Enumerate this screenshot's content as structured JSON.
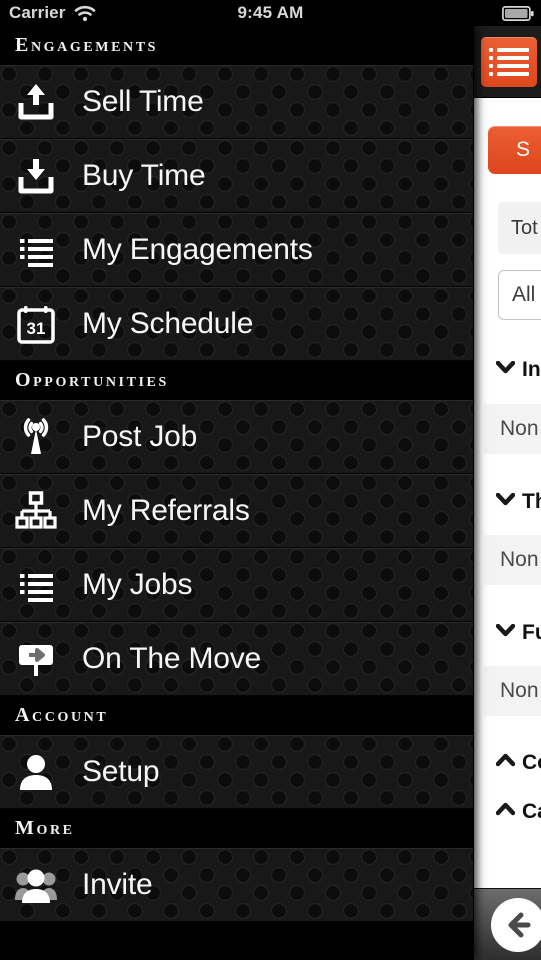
{
  "status_bar": {
    "carrier": "Carrier",
    "time": "9:45 AM",
    "wifi_icon": "wifi-icon",
    "battery_icon": "battery-icon"
  },
  "drawer": {
    "sections": [
      {
        "header": "Engagements",
        "items": [
          {
            "label": "Sell Time",
            "icon": "upload-tray-icon"
          },
          {
            "label": "Buy Time",
            "icon": "download-tray-icon"
          },
          {
            "label": "My Engagements",
            "icon": "list-icon"
          },
          {
            "label": "My Schedule",
            "icon": "calendar-31-icon"
          }
        ]
      },
      {
        "header": "Opportunities",
        "items": [
          {
            "label": "Post Job",
            "icon": "broadcast-antenna-icon"
          },
          {
            "label": "My Referrals",
            "icon": "org-chart-icon"
          },
          {
            "label": "My Jobs",
            "icon": "list-icon"
          },
          {
            "label": "On The Move",
            "icon": "signpost-arrow-icon"
          }
        ]
      },
      {
        "header": "Account",
        "items": [
          {
            "label": "Setup",
            "icon": "person-icon"
          }
        ]
      },
      {
        "header": "More",
        "items": [
          {
            "label": "Invite",
            "icon": "group-people-icon"
          }
        ]
      }
    ]
  },
  "content_panel": {
    "menu_button_icon": "hamburger-list-icon",
    "primary_button_label": "S",
    "total_field_label": "Tot",
    "filter_select_value": "All",
    "sections": [
      {
        "label": "In",
        "state": "expanded",
        "chevron": "chevron-down-icon",
        "value": "Non"
      },
      {
        "label": "Th",
        "state": "expanded",
        "chevron": "chevron-down-icon",
        "value": "Non"
      },
      {
        "label": "Fu",
        "state": "expanded",
        "chevron": "chevron-down-icon",
        "value": "Non"
      },
      {
        "label": "Co",
        "state": "collapsed",
        "chevron": "chevron-up-icon"
      },
      {
        "label": "Ca",
        "state": "collapsed",
        "chevron": "chevron-up-icon"
      }
    ],
    "back_button_icon": "arrow-left-circle-icon"
  },
  "colors": {
    "accent_orange": "#e2552c",
    "drawer_background": "#181818",
    "panel_background": "#ffffff"
  }
}
